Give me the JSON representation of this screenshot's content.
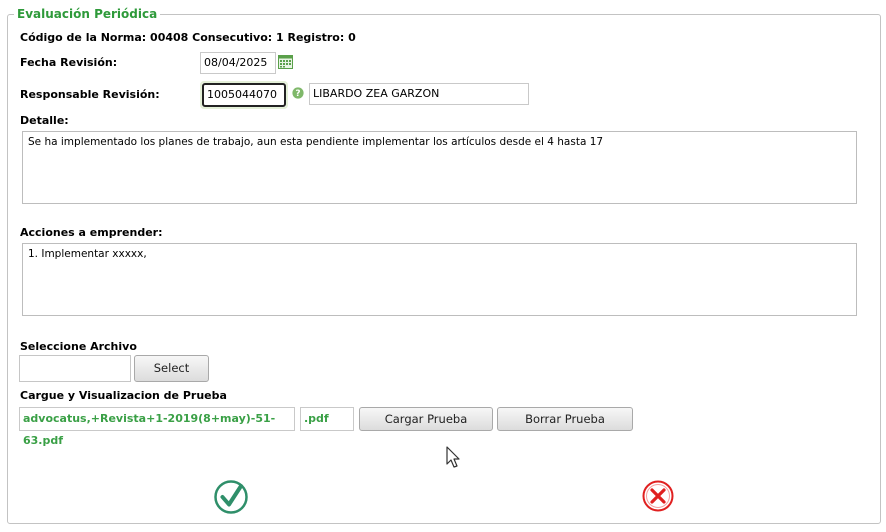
{
  "legend": "Evaluación Periódica",
  "norma": {
    "codigo_label": "Código de la Norma:",
    "codigo_value": "00408",
    "consecutivo_label": "Consecutivo:",
    "consecutivo_value": "1",
    "registro_label": "Registro:",
    "registro_value": "0"
  },
  "fecha": {
    "label": "Fecha Revisión:",
    "value": "08/04/2025"
  },
  "responsable": {
    "label": "Responsable Revisión:",
    "id_value": "1005044070",
    "name_value": "LIBARDO ZEA GARZON"
  },
  "detalle": {
    "label": "Detalle:",
    "value": "Se ha implementado los planes de trabajo, aun esta pendiente implementar los artículos desde el 4 hasta 17"
  },
  "acciones": {
    "label": "Acciones a emprender:",
    "value": "1. Implementar xxxxx,"
  },
  "archivo": {
    "label": "Seleccione Archivo",
    "value": "",
    "select_label": "Select"
  },
  "prueba": {
    "label": "Cargue y Visualizacion de Prueba",
    "filename": "advocatus,+Revista+1-2019(8+may)-51-63.pdf",
    "extension": ".pdf",
    "cargar_label": "Cargar Prueba",
    "borrar_label": "Borrar Prueba"
  },
  "colors": {
    "legend": "#2e9a3a",
    "accept": "#2f8f6a",
    "cancel": "#e02020"
  },
  "icons": {
    "calendar": "calendar-icon",
    "help": "help-icon",
    "accept": "check-circle-icon",
    "cancel": "close-circle-icon",
    "cursor": "mouse-cursor-icon"
  }
}
